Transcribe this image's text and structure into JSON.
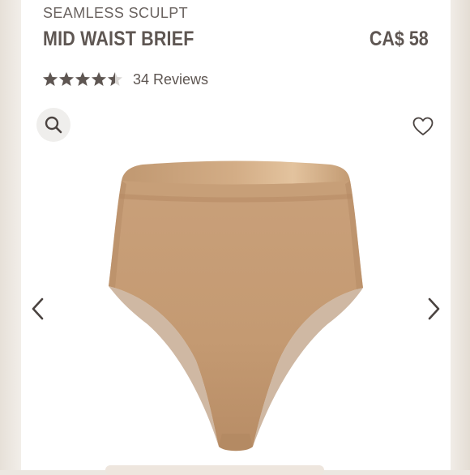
{
  "product": {
    "collection": "SEAMLESS SCULPT",
    "name": "MID WAIST BRIEF",
    "price": "CA$ 58",
    "rating": 4.5,
    "rating_max": 5,
    "reviews_label": "34 Reviews",
    "color": "#c4996f"
  },
  "icons": {
    "search": "search-icon",
    "favorite": "heart-icon",
    "previous": "chevron-left-icon",
    "next": "chevron-right-icon"
  },
  "colors": {
    "text": "#5e5652",
    "star_filled": "#5e5652",
    "star_empty": "#d9d6d3"
  }
}
